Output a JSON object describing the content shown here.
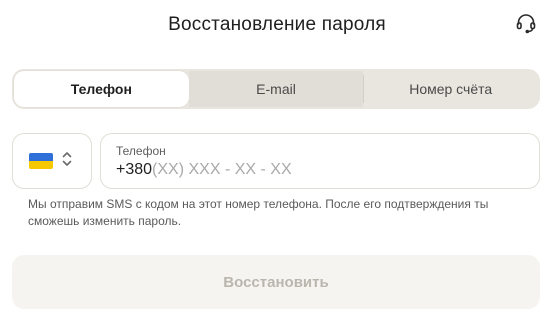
{
  "header": {
    "title": "Восстановление пароля",
    "support_icon": "headset-support-icon"
  },
  "tabs": [
    {
      "label": "Телефон",
      "active": true
    },
    {
      "label": "E-mail",
      "active": false
    },
    {
      "label": "Номер счёта",
      "active": false
    }
  ],
  "country": {
    "flag": "ukraine-flag-icon",
    "chevron_icon": "chevron-updown-icon",
    "colors": {
      "blue": "#2f6fd8",
      "yellow": "#f5c800"
    }
  },
  "phone": {
    "label": "Телефон",
    "prefix": "+380",
    "mask": "(XX) XXX - XX - XX"
  },
  "hint": "Мы отправим SMS с кодом на этот номер телефона. После его подтверждения ты сможешь изменить пароль.",
  "submit": {
    "label": "Восстановить",
    "disabled": true
  },
  "colors": {
    "tab_bg": "#e8e6df",
    "button_bg_disabled": "#f5f4f1",
    "button_text_disabled": "#b9b6ae"
  }
}
